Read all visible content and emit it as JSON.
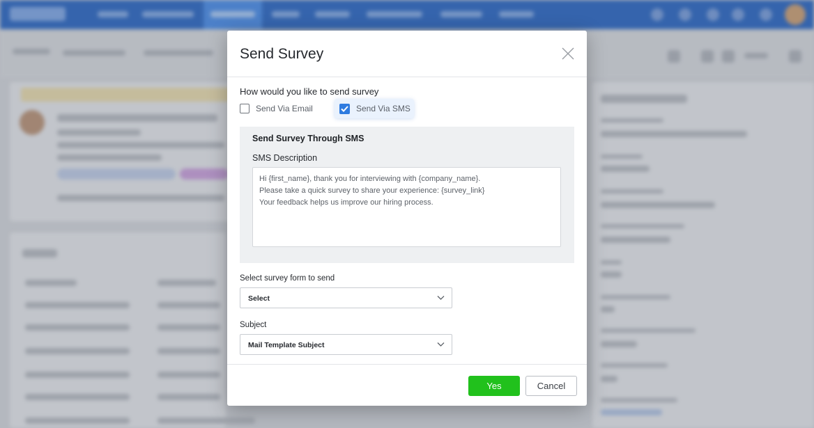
{
  "dialog": {
    "title": "Send Survey",
    "question": "How would you like to send survey",
    "options": [
      {
        "label": "Send Via Email",
        "checked": false
      },
      {
        "label": "Send Via SMS",
        "checked": true
      }
    ],
    "sms": {
      "heading": "Send Survey Through SMS",
      "description_label": "SMS Description",
      "message": "Hi {first_name}, thank you for interviewing with {company_name}.\nPlease take a quick survey to share your experience: {survey_link}\nYour feedback helps us improve our hiring process."
    },
    "survey_form": {
      "label": "Select survey form to send",
      "value": "Select"
    },
    "subject": {
      "label": "Subject",
      "value": "Mail Template Subject"
    },
    "buttons": {
      "yes": "Yes",
      "cancel": "Cancel"
    }
  },
  "colors": {
    "accent": "#2e7be0",
    "confirm": "#21c11c",
    "topbar": "#1f5fbf"
  },
  "icons": [
    "close-icon",
    "checkbox-checked-icon",
    "chevron-down-icon"
  ]
}
